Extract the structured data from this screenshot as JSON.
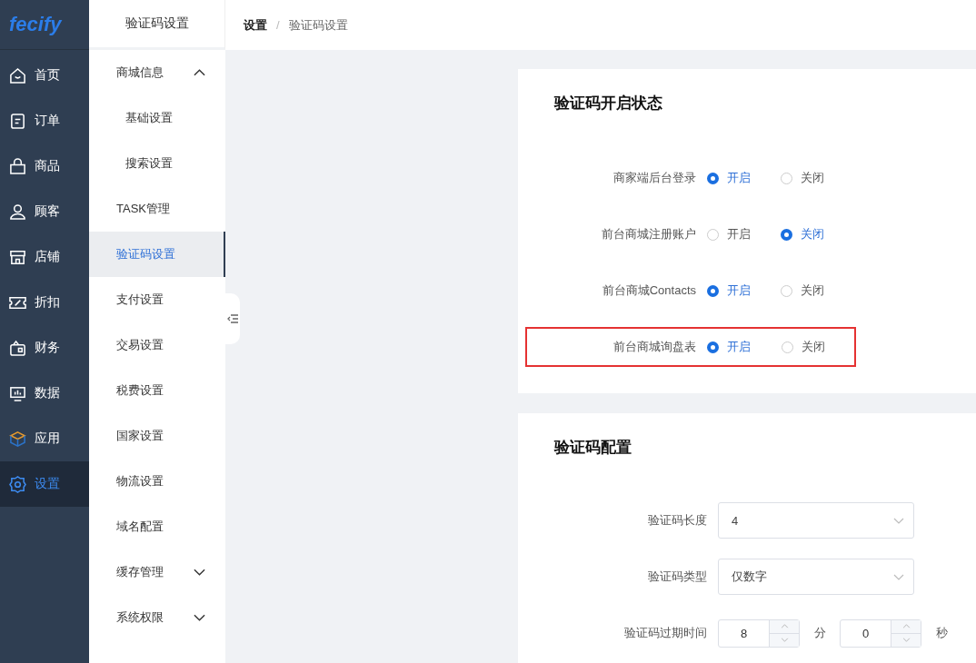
{
  "logo": {
    "text": "fecify"
  },
  "nav": [
    {
      "label": "首页",
      "kind": "home",
      "selected": false
    },
    {
      "label": "订单",
      "kind": "order",
      "selected": false
    },
    {
      "label": "商品",
      "kind": "bag",
      "selected": false
    },
    {
      "label": "顾客",
      "kind": "user",
      "selected": false
    },
    {
      "label": "店铺",
      "kind": "store",
      "selected": false
    },
    {
      "label": "折扣",
      "kind": "discount",
      "selected": false
    },
    {
      "label": "财务",
      "kind": "wallet",
      "selected": false
    },
    {
      "label": "数据",
      "kind": "chart",
      "selected": false
    },
    {
      "label": "应用",
      "kind": "box",
      "selected": false
    },
    {
      "label": "设置",
      "kind": "gear",
      "selected": true
    }
  ],
  "submenu": {
    "title": "验证码设置",
    "items": [
      {
        "label": "商城信息",
        "selected": false,
        "expanded": true,
        "children": [
          {
            "label": "基础设置",
            "selected": false
          },
          {
            "label": "搜索设置",
            "selected": false
          }
        ]
      },
      {
        "label": "TASK管理",
        "selected": false
      },
      {
        "label": "验证码设置",
        "selected": true
      },
      {
        "label": "支付设置",
        "selected": false
      },
      {
        "label": "交易设置",
        "selected": false
      },
      {
        "label": "税费设置",
        "selected": false
      },
      {
        "label": "国家设置",
        "selected": false
      },
      {
        "label": "物流设置",
        "selected": false
      },
      {
        "label": "域名配置",
        "selected": false
      },
      {
        "label": "缓存管理",
        "selected": false,
        "expanded": false
      },
      {
        "label": "系统权限",
        "selected": false,
        "expanded": false
      }
    ]
  },
  "breadcrumb": {
    "separator": "/",
    "items": [
      "设置",
      "验证码设置"
    ]
  },
  "status_card": {
    "title": "验证码开启状态",
    "rows": [
      {
        "label": "商家端后台登录",
        "highlighted": false,
        "options": [
          {
            "label": "开启",
            "selected": true
          },
          {
            "label": "关闭",
            "selected": false
          }
        ]
      },
      {
        "label": "前台商城注册账户",
        "highlighted": false,
        "options": [
          {
            "label": "开启",
            "selected": false
          },
          {
            "label": "关闭",
            "selected": true
          }
        ]
      },
      {
        "label": "前台商城Contacts",
        "highlighted": false,
        "options": [
          {
            "label": "开启",
            "selected": true
          },
          {
            "label": "关闭",
            "selected": false
          }
        ]
      },
      {
        "label": "前台商城询盘表",
        "highlighted": true,
        "options": [
          {
            "label": "开启",
            "selected": true
          },
          {
            "label": "关闭",
            "selected": false
          }
        ]
      }
    ]
  },
  "config_card": {
    "title": "验证码配置",
    "fields": [
      {
        "kind": "select",
        "label": "验证码长度",
        "value": "4"
      },
      {
        "kind": "select",
        "label": "验证码类型",
        "value": "仅数字"
      },
      {
        "kind": "duration",
        "label": "验证码过期时间",
        "parts": [
          {
            "value": "8",
            "unit": "分"
          },
          {
            "value": "0",
            "unit": "秒"
          }
        ]
      }
    ]
  }
}
